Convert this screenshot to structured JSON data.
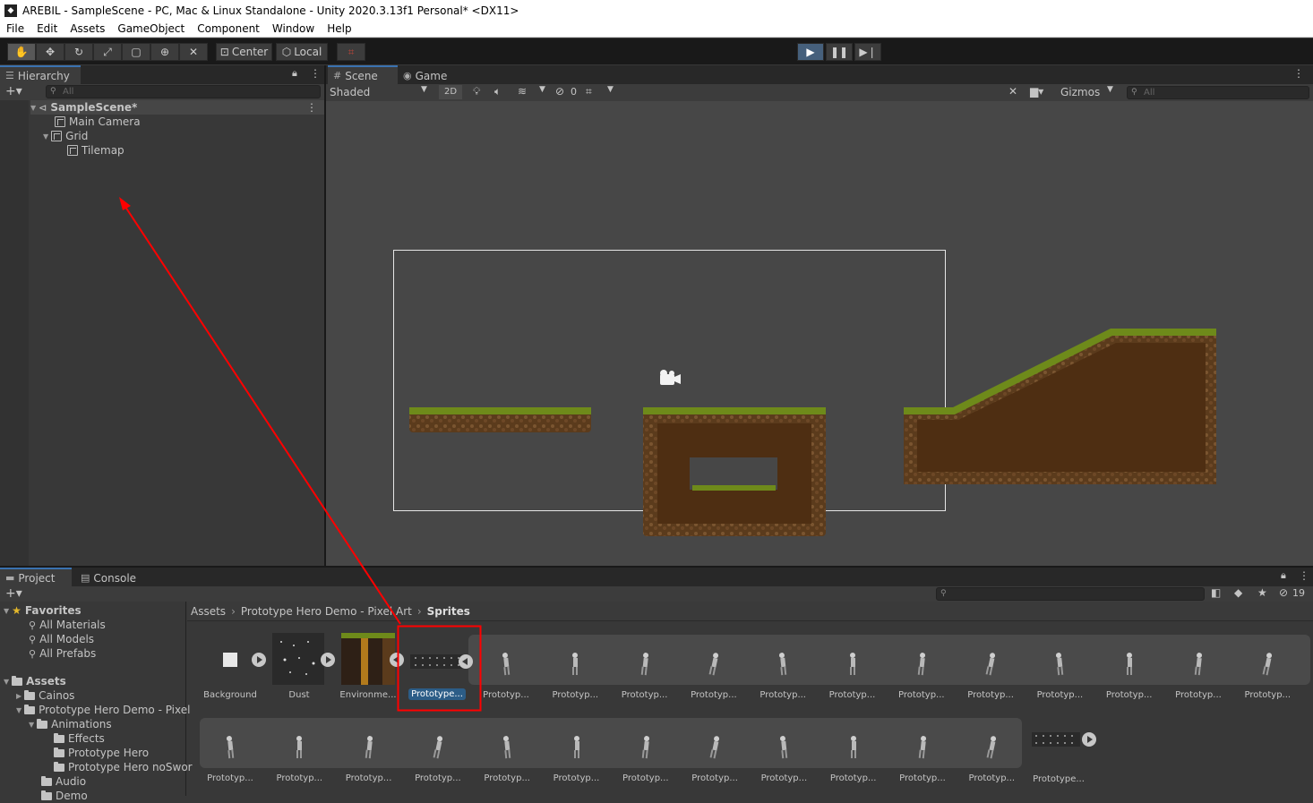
{
  "window": {
    "title": "AREBIL - SampleScene - PC, Mac & Linux Standalone - Unity 2020.3.13f1 Personal* <DX11>"
  },
  "menu": [
    "File",
    "Edit",
    "Assets",
    "GameObject",
    "Component",
    "Window",
    "Help"
  ],
  "toolbar": {
    "center_label": "Center",
    "local_label": "Local"
  },
  "hierarchy": {
    "tab_label": "Hierarchy",
    "search_placeholder": "All",
    "scene_name": "SampleScene*",
    "items": [
      "Main Camera",
      "Grid",
      "Tilemap"
    ]
  },
  "scene_view": {
    "tab_scene": "Scene",
    "tab_game": "Game",
    "shading": "Shaded",
    "mode_2d": "2D",
    "hidden_count": "0",
    "gizmos_label": "Gizmos",
    "search_placeholder": "All"
  },
  "project": {
    "tab_project": "Project",
    "tab_console": "Console",
    "hidden_count": "19",
    "favorites_label": "Favorites",
    "favorites": [
      "All Materials",
      "All Models",
      "All Prefabs"
    ],
    "assets_label": "Assets",
    "tree": [
      "Cainos",
      "Prototype Hero Demo - Pixel",
      "Animations",
      "Effects",
      "Prototype Hero",
      "Prototype Hero noSwor",
      "Audio",
      "Demo"
    ],
    "breadcrumbs": [
      "Assets",
      "Prototype Hero Demo - Pixel Art",
      "Sprites"
    ],
    "row1_assets": [
      "Background",
      "Dust",
      "Environme...",
      "Prototype..."
    ],
    "row1_frames": [
      "Prototyp...",
      "Prototyp...",
      "Prototyp...",
      "Prototyp...",
      "Prototyp...",
      "Prototyp...",
      "Prototyp...",
      "Prototyp...",
      "Prototyp...",
      "Prototyp...",
      "Prototyp...",
      "Prototyp..."
    ],
    "row2_frames": [
      "Prototyp...",
      "Prototyp...",
      "Prototyp...",
      "Prototyp...",
      "Prototyp...",
      "Prototyp...",
      "Prototyp...",
      "Prototyp...",
      "Prototyp...",
      "Prototyp...",
      "Prototyp...",
      "Prototyp..."
    ],
    "row2_last": "Prototype..."
  },
  "colors": {
    "accent": "#3a72b0",
    "annotation": "#ff0000",
    "grass": "#6e8a1a",
    "dirt": "#5a3a1c"
  }
}
